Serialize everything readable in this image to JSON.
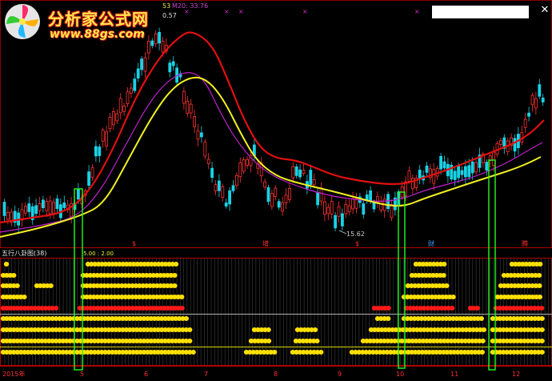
{
  "header": {
    "tag_left": "53",
    "ma_label": "M20: 33.76",
    "sub_value": "0.57"
  },
  "logo": {
    "title": "分析家公式网",
    "url": "www.88gs.com"
  },
  "price_panel": {
    "low_label": "15.62",
    "signals": [
      {
        "text": "$",
        "color": "#ff3030"
      },
      {
        "text": "增",
        "color": "#ff3030"
      },
      {
        "text": "$",
        "color": "#ff3030"
      },
      {
        "text": "财",
        "color": "#3aa0ff"
      },
      {
        "text": "腾",
        "color": "#ff3030"
      }
    ]
  },
  "indicator_panel": {
    "title": "五行八卦图(38)",
    "values": "5.00 : 2.00"
  },
  "time_axis": {
    "labels": [
      "2015年",
      "5",
      "6",
      "7",
      "8",
      "9",
      "10",
      "11",
      "12"
    ]
  },
  "colors": {
    "up": "#ff3232",
    "down": "#19d2e6",
    "ma_red": "#e01010",
    "ma_magenta": "#c020d0",
    "ma_yellow": "#f0f020",
    "dots_yellow": "#ffe000",
    "dots_red": "#ff1818",
    "highlight_green": "#20ff20"
  },
  "icons": {
    "close": "close-icon",
    "logo": "pinwheel-logo-icon"
  }
}
